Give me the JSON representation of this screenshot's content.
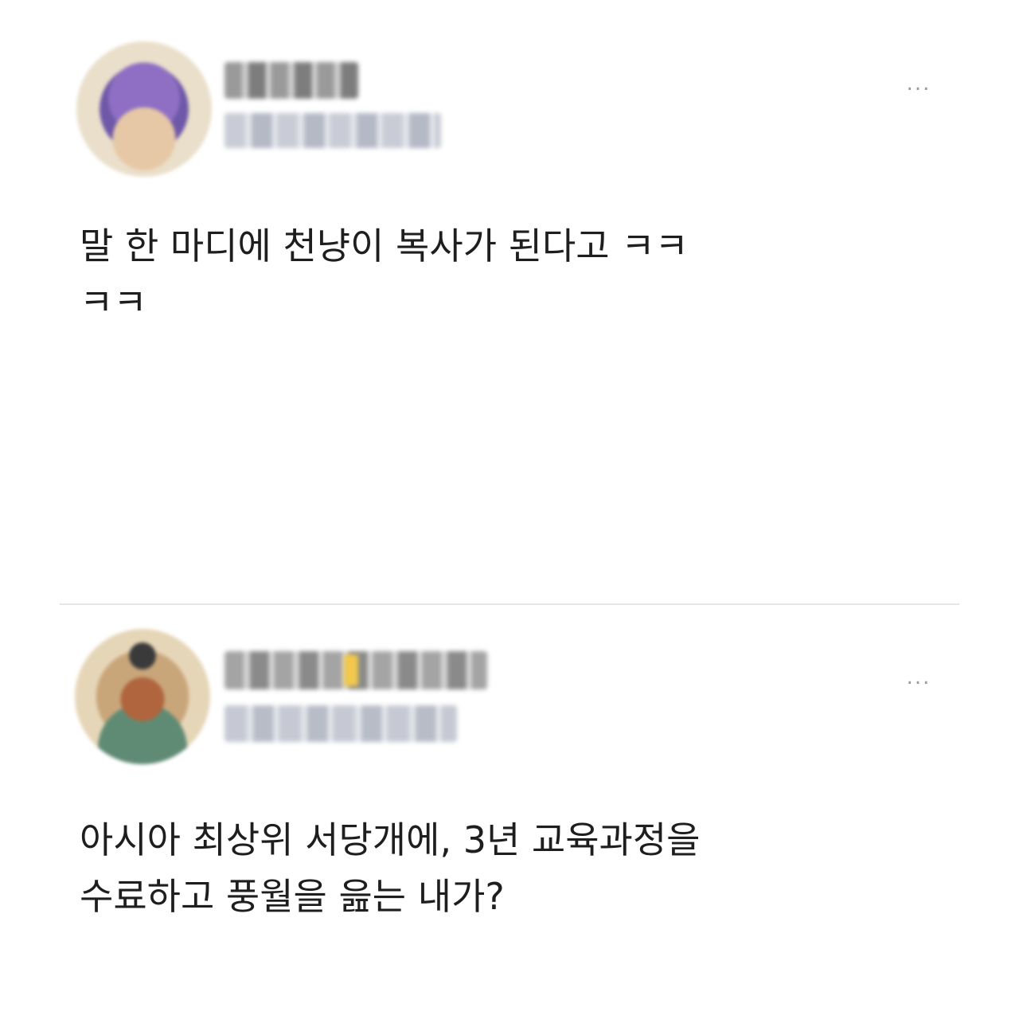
{
  "posts": [
    {
      "text": "말 한 마디에 천냥이 복사가 된다고 ㅋㅋ\nㅋㅋ",
      "more_label": "...",
      "avatar_icon": "user-avatar-icon-blurred",
      "avatar_colors": [
        "#e8dcc4",
        "#8e6fc4",
        "#d8b896"
      ]
    },
    {
      "text": "아시아 최상위 서당개에, 3년 교육과정을\n수료하고 풍월을 읊는 내가?",
      "more_label": "...",
      "avatar_icon": "user-avatar-icon-blurred",
      "avatar_colors": [
        "#d6c09a",
        "#a8663e",
        "#5f8b74"
      ]
    }
  ],
  "colors": {
    "background": "#ffffff",
    "text": "#1e1e1e",
    "divider": "#e6e6e6",
    "more_icon": "#9a9a9a"
  }
}
